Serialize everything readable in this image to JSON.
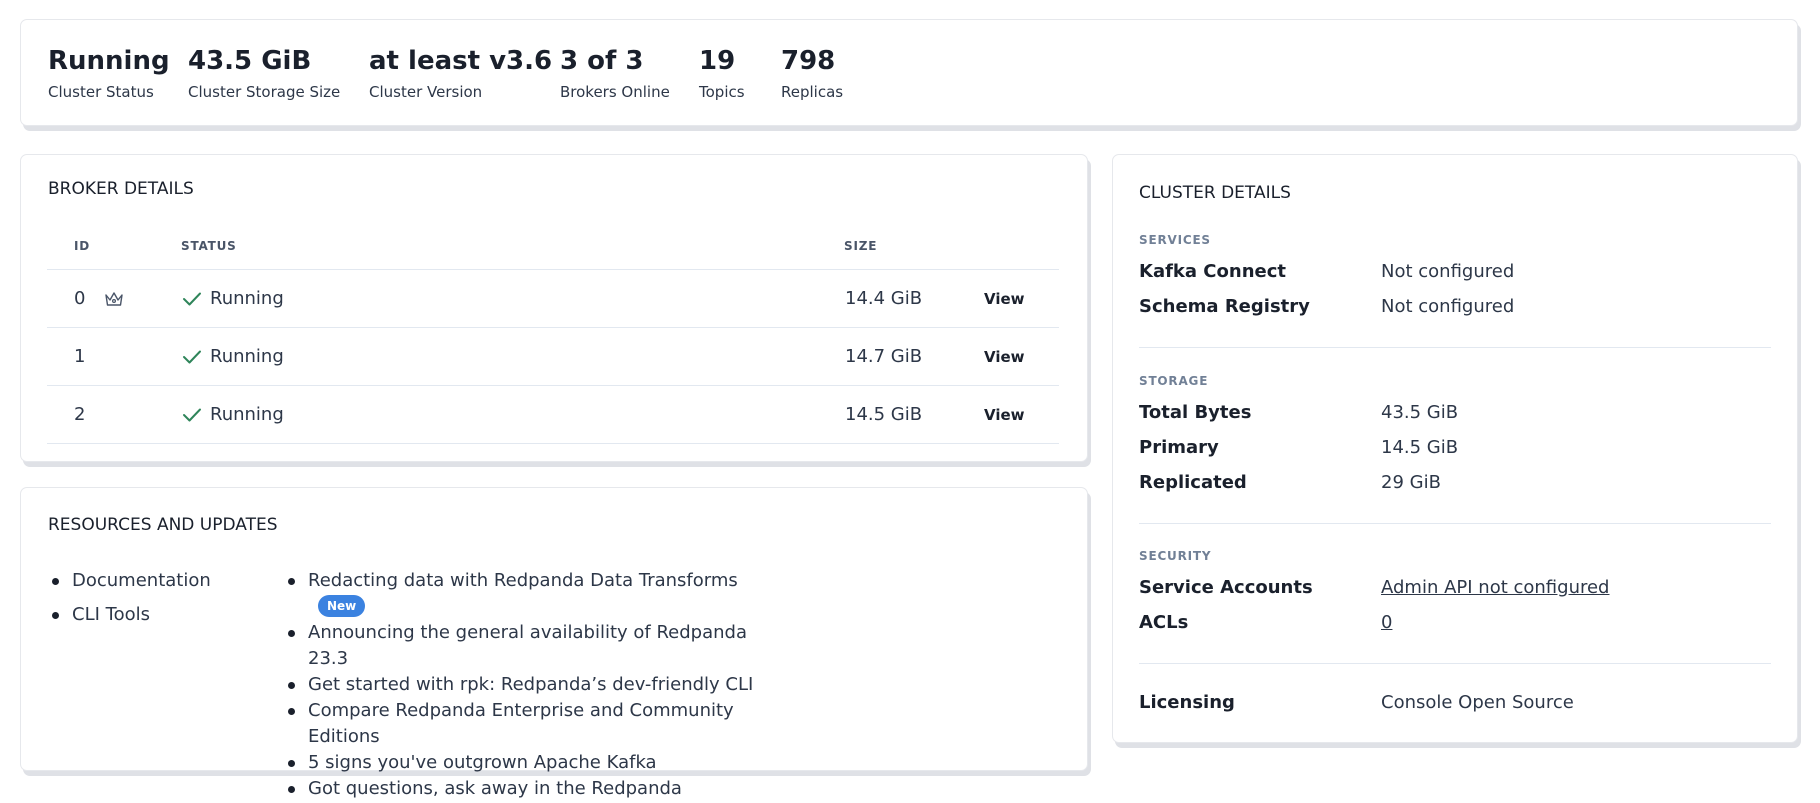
{
  "stats": [
    {
      "value": "Running",
      "label": "Cluster Status"
    },
    {
      "value": "43.5 GiB",
      "label": "Cluster Storage Size"
    },
    {
      "value": "at least v3.6",
      "label": "Cluster Version"
    },
    {
      "value": "3 of 3",
      "label": "Brokers Online"
    },
    {
      "value": "19",
      "label": "Topics"
    },
    {
      "value": "798",
      "label": "Replicas"
    }
  ],
  "broker_details": {
    "title": "BROKER DETAILS",
    "columns": {
      "id": "ID",
      "status": "STATUS",
      "size": "SIZE"
    },
    "rows": [
      {
        "id": "0",
        "is_controller": true,
        "status": "Running",
        "size": "14.4 GiB",
        "action": "View"
      },
      {
        "id": "1",
        "is_controller": false,
        "status": "Running",
        "size": "14.7 GiB",
        "action": "View"
      },
      {
        "id": "2",
        "is_controller": false,
        "status": "Running",
        "size": "14.5 GiB",
        "action": "View"
      }
    ],
    "icons": {
      "controller": "crown-icon",
      "status": "check-icon"
    }
  },
  "resources": {
    "title": "RESOURCES AND UPDATES",
    "docs": [
      "Documentation",
      "CLI Tools"
    ],
    "news": [
      {
        "text": "Redacting data with Redpanda Data Transforms",
        "badge": "New"
      },
      {
        "text": "Announcing the general availability of Redpanda 23.3"
      },
      {
        "text": "Get started with rpk: Redpanda’s dev-friendly CLI"
      },
      {
        "text": "Compare Redpanda Enterprise and Community Editions"
      },
      {
        "text": "5 signs you've outgrown Apache Kafka"
      },
      {
        "text": "Got questions, ask away in the Redpanda Community on Slack"
      }
    ]
  },
  "cluster_details": {
    "title": "CLUSTER DETAILS",
    "services": {
      "label": "SERVICES",
      "kafka_connect": {
        "key": "Kafka Connect",
        "value": "Not configured"
      },
      "schema_registry": {
        "key": "Schema Registry",
        "value": "Not configured"
      }
    },
    "storage": {
      "label": "STORAGE",
      "total": {
        "key": "Total Bytes",
        "value": "43.5 GiB"
      },
      "primary": {
        "key": "Primary",
        "value": "14.5 GiB"
      },
      "replicated": {
        "key": "Replicated",
        "value": "29 GiB"
      }
    },
    "security": {
      "label": "SECURITY",
      "service_accounts": {
        "key": "Service Accounts",
        "value": "Admin API not configured"
      },
      "acls": {
        "key": "ACLs",
        "value": "0"
      }
    },
    "licensing": {
      "key": "Licensing",
      "value": "Console Open Source"
    }
  },
  "colors": {
    "accent_badge": "#3b82e0",
    "success": "#2f855a",
    "text": "#1a202c"
  }
}
